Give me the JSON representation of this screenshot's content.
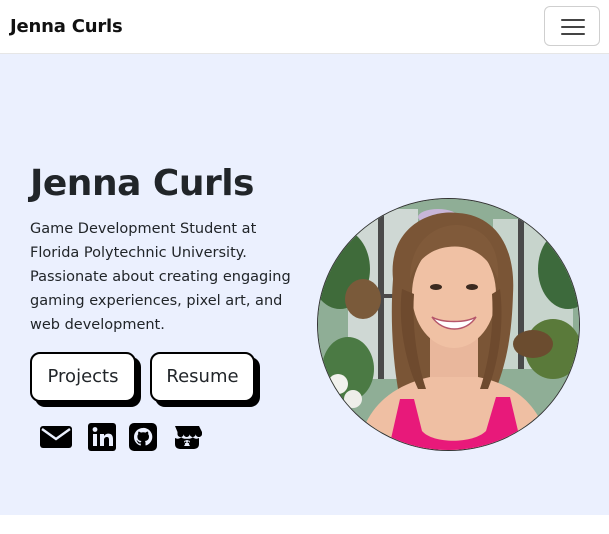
{
  "navbar": {
    "brand": "Jenna Curls",
    "toggler_icon": "hamburger-menu-icon"
  },
  "hero": {
    "title": "Jenna Curls",
    "description": "Game Development Student at Florida Polytechnic University. Passionate about creating engaging gaming experiences, pixel art, and web development.",
    "buttons": {
      "projects": "Projects",
      "resume": "Resume"
    },
    "social_icons": [
      "email-icon",
      "linkedin-icon",
      "github-icon",
      "itch-io-icon"
    ],
    "photo_icon": "profile-photo"
  },
  "colors": {
    "hero_background": "#ebf0fe",
    "text": "#212529",
    "button_shadow": "#000000",
    "photo_accent_pink": "#e8197a"
  }
}
